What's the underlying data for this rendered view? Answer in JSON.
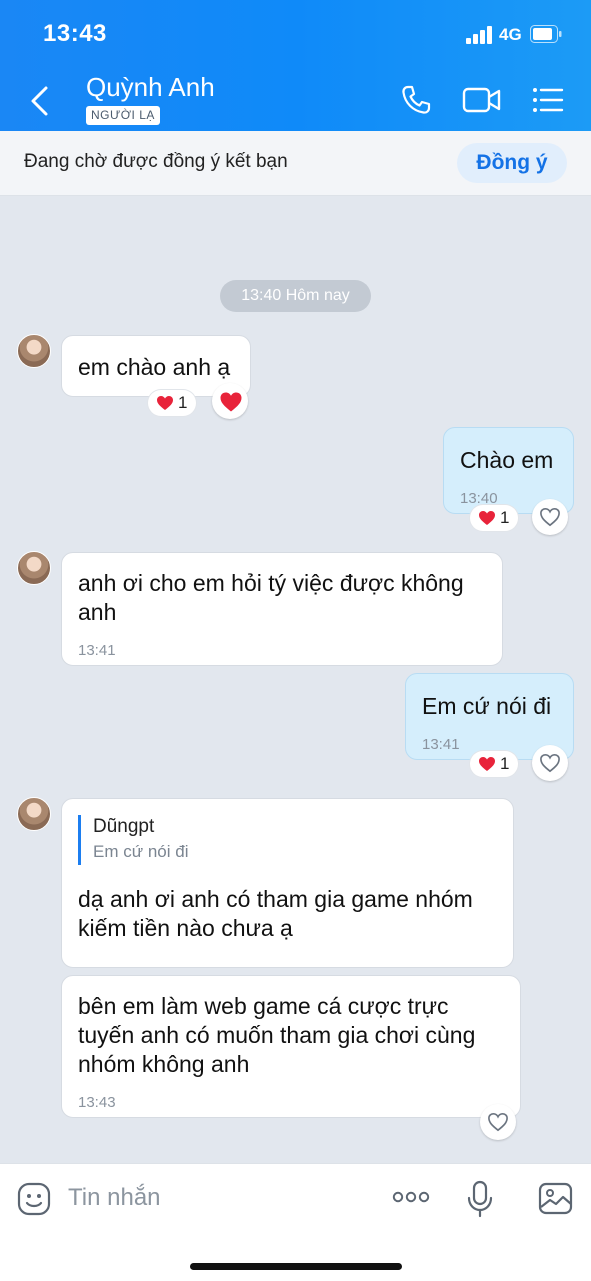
{
  "status": {
    "time": "13:43",
    "network": "4G"
  },
  "header": {
    "contact_name": "Quỳnh Anh",
    "badge": "NGƯỜI LẠ"
  },
  "request_bar": {
    "text": "Đang chờ được đồng ý kết bạn",
    "agree_label": "Đồng ý"
  },
  "chat": {
    "date_pill": "13:40 Hôm nay",
    "messages": [
      {
        "from": "them",
        "text": "em chào anh ạ",
        "reaction_count": "1"
      },
      {
        "from": "me",
        "text": "Chào em",
        "time": "13:40",
        "reaction_count": "1"
      },
      {
        "from": "them",
        "lines": [
          "anh ơi cho em hỏi tý việc được không",
          "anh"
        ],
        "time": "13:41"
      },
      {
        "from": "me",
        "text": "Em cứ nói đi",
        "time": "13:41",
        "reaction_count": "1"
      },
      {
        "from": "them",
        "quote_author": "Dũngpt",
        "quote_text": "Em cứ nói đi",
        "lines": [
          "dạ anh ơi anh có tham gia game nhóm",
          "kiếm tiền nào chưa ạ"
        ]
      },
      {
        "from": "them",
        "lines": [
          "bên em làm web game cá cược trực",
          "tuyến anh có muốn tham gia chơi cùng",
          "nhóm không anh"
        ],
        "time": "13:43"
      }
    ]
  },
  "composer": {
    "placeholder": "Tin nhắn"
  },
  "colors": {
    "header_blue": "#1a87f5",
    "accent_blue": "#1472e6",
    "my_bubble": "#d5eefc",
    "heart_red": "#e8233a"
  }
}
